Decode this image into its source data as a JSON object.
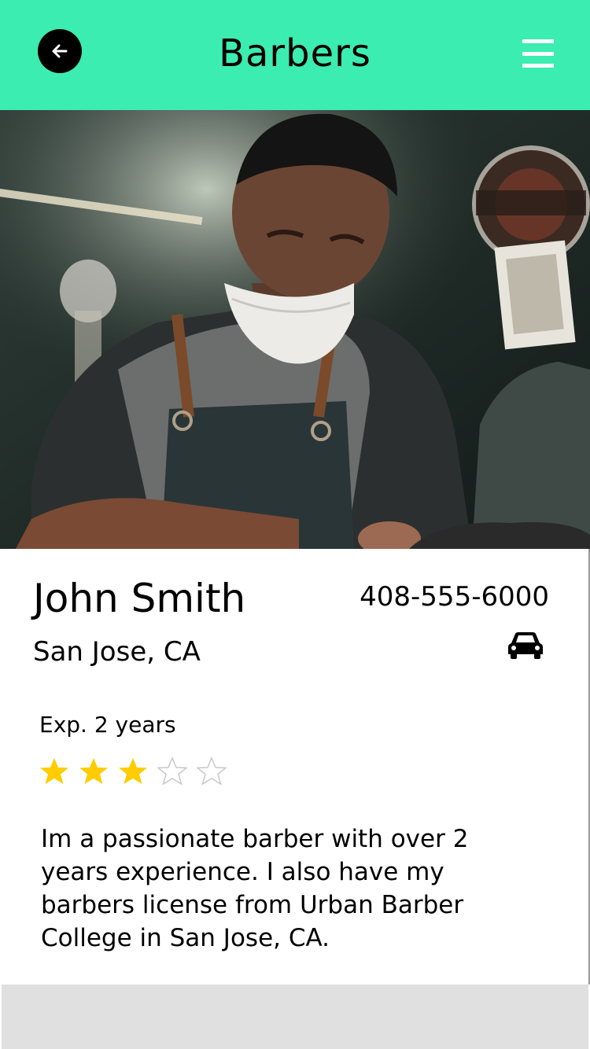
{
  "header": {
    "title": "Barbers",
    "bg_color": "#3bedb0",
    "back_icon": "arrow-left-icon",
    "menu_icon": "hamburger-menu-icon"
  },
  "hero": {
    "photo": "barber-photo"
  },
  "profile": {
    "name": "John Smith",
    "location": "San Jose, CA",
    "phone": "408-555-6000",
    "vehicle_icon": "car-icon",
    "experience": "Exp. 2 years",
    "rating": 3,
    "rating_max": 5,
    "star_color": "#ffcc00",
    "bio": "Im a passionate barber with over 2 years experience. I also have my barbers license from Urban Barber College in San Jose, CA."
  }
}
